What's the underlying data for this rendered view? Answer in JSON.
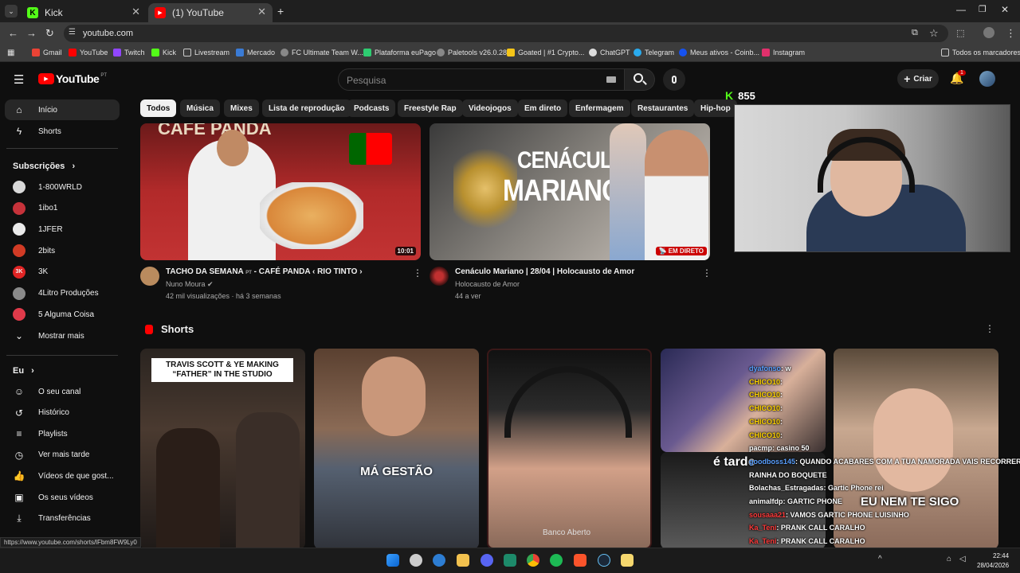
{
  "browser": {
    "tabs": [
      {
        "label": "Kick",
        "active": false
      },
      {
        "label": "(1) YouTube",
        "active": true
      }
    ],
    "url": "youtube.com",
    "bookmarks": [
      "Gmail",
      "YouTube",
      "Twitch",
      "Kick",
      "Livestream",
      "Mercado",
      "FC Ultimate Team W...",
      "Plataforma euPago",
      "Paletools v26.0.28",
      "Goated | #1 Crypto...",
      "ChatGPT",
      "Telegram",
      "Meus ativos - Coinb...",
      "Instagram"
    ],
    "all_bookmarks": "Todos os marcadores",
    "status_url": "https://www.youtube.com/shorts/lFbm8FW9Ly0"
  },
  "youtube": {
    "logo": "YouTube",
    "region": "PT",
    "search_placeholder": "Pesquisa",
    "create_label": "Criar",
    "notif_count": "1",
    "chips": [
      "Todos",
      "Música",
      "Mixes",
      "Lista de reprodução",
      "Podcasts",
      "Freestyle Rap",
      "Videojogos",
      "Em direto",
      "Enfermagem",
      "Restaurantes",
      "Hip-hop"
    ],
    "sidebar": {
      "main": [
        {
          "label": "Início",
          "icon": "home-icon"
        },
        {
          "label": "Shorts",
          "icon": "shorts-icon"
        }
      ],
      "subs_heading": "Subscrições",
      "subs": [
        {
          "label": "1-800WRLD",
          "badge": "",
          "color": "#d9d9d9"
        },
        {
          "label": "1ibo1",
          "badge": "",
          "color": "#c6323a"
        },
        {
          "label": "1JFER",
          "badge": "",
          "color": "#eaeaea"
        },
        {
          "label": "2bits",
          "badge": "",
          "color": "#d13b25"
        },
        {
          "label": "3K",
          "badge": "3K",
          "color": "#e02424"
        },
        {
          "label": "4Litro Produções",
          "badge": "",
          "color": "#8a8a8a"
        },
        {
          "label": "5 Alguma Coisa",
          "badge": "",
          "color": "#e03a4a"
        }
      ],
      "show_more": "Mostrar mais",
      "you_heading": "Eu",
      "you": [
        {
          "label": "O seu canal",
          "icon": "channel-icon"
        },
        {
          "label": "Histórico",
          "icon": "history-icon"
        },
        {
          "label": "Playlists",
          "icon": "playlists-icon"
        },
        {
          "label": "Ver mais tarde",
          "icon": "watch-later-icon"
        },
        {
          "label": "Vídeos de que gost...",
          "icon": "liked-icon"
        },
        {
          "label": "Os seus vídeos",
          "icon": "your-videos-icon"
        },
        {
          "label": "Transferências",
          "icon": "downloads-icon"
        }
      ]
    },
    "videos": [
      {
        "title": "TACHO DA SEMANA",
        "lang": "PT",
        "title_rest": " - CAFÉ PANDA ‹ RIO TINTO ›",
        "channel": "Nuno Moura",
        "meta": "42 mil visualizações · há 3 semanas",
        "duration": "10:01",
        "thumb_text": "CAFÉ PANDA"
      },
      {
        "title": "Cenáculo Mariano | 28/04 | Holocausto de Amor",
        "channel": "Holocausto de Amor",
        "meta": "44 a ver",
        "live_badge": "EM DIRETO",
        "thumb_line1": "CENÁCULO",
        "thumb_line2": "MARIANO"
      }
    ],
    "shorts_heading": "Shorts",
    "shorts": [
      {
        "overlay": "TRAVIS SCOTT & YE MAKING “FATHER” IN THE STUDIO"
      },
      {
        "overlay": "MÁ GESTÃO"
      },
      {
        "overlay": "Banco Aberto"
      },
      {
        "overlay": "é tarde"
      },
      {
        "overlay": "EU NEM TE SIGO"
      }
    ]
  },
  "stream": {
    "viewer_count": "855",
    "chat": [
      {
        "user": "dyafonso",
        "msg": ": w",
        "color": "#5aa0ff"
      },
      {
        "user": "CHICO10",
        "msg": ": ",
        "color": "#ffd400"
      },
      {
        "user": "CHICO10",
        "msg": ": ",
        "color": "#ffd400"
      },
      {
        "user": "CHICO10",
        "msg": ": ",
        "color": "#ffd400"
      },
      {
        "user": "CHICO10",
        "msg": ": ",
        "color": "#ffd400"
      },
      {
        "user": "CHICO10",
        "msg": ": ",
        "color": "#ffd400"
      },
      {
        "user": "pacmp",
        "msg": ": casino 50",
        "color": "#ffffff"
      },
      {
        "user": "goodboss145",
        "msg": ": QUANDO ACABARES COM A TUA NAMORADA VAIS RECORRER A",
        "color": "#5aa0ff"
      },
      {
        "user": "",
        "msg": "RAINHA DO BOQUETE",
        "color": "#ffffff"
      },
      {
        "user": "Bolachas_Estragadas",
        "msg": ": Gartic Phone rei",
        "color": "#ffffff"
      },
      {
        "user": "animalfdp",
        "msg": ": GARTIC PHONE",
        "color": "#ffffff"
      },
      {
        "user": "sousaaa21",
        "msg": ": VAMOS GARTIC PHONE LUISINHO",
        "color": "#ff3b3b"
      },
      {
        "user": "Ka_Teni",
        "msg": ": PRANK CALL CARALHO",
        "color": "#ff3b3b"
      },
      {
        "user": "Ka_Teni",
        "msg": ": PRANK CALL CARALHO",
        "color": "#ff3b3b"
      },
      {
        "user": "sousaaa21",
        "msg": ": VAMOS GARTIC PHONE LUISINHO",
        "color": "#ff3b3b"
      }
    ]
  },
  "taskbar": {
    "time": "22:44",
    "date": "28/04/2026"
  }
}
